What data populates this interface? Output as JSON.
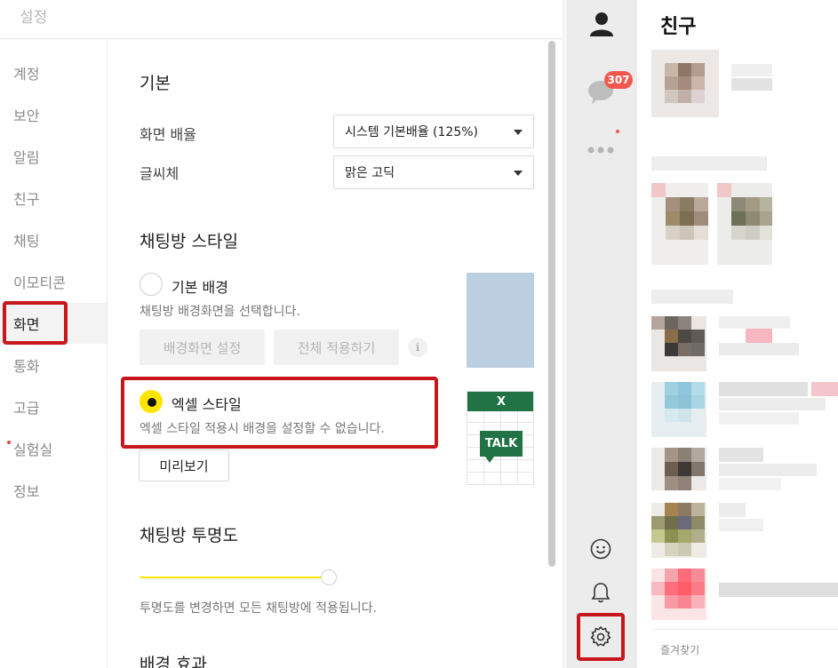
{
  "settings": {
    "title": "설정",
    "nav": [
      "계정",
      "보안",
      "알림",
      "친구",
      "채팅",
      "이모티콘",
      "화면",
      "통화",
      "고급",
      "실험실",
      "정보"
    ],
    "active_nav": "화면",
    "basic": {
      "heading": "기본",
      "scale_label": "화면 배율",
      "scale_value": "시스템 기본배율 (125%)",
      "font_label": "글씨체",
      "font_value": "맑은 고딕"
    },
    "chat_style": {
      "heading": "채팅방 스타일",
      "basic_bg_label": "기본 배경",
      "basic_bg_desc": "채팅방 배경화면을 선택합니다.",
      "set_bg_button": "배경화면 설정",
      "apply_all_button": "전체 적용하기",
      "info_icon": "i",
      "excel_label": "엑셀 스타일",
      "excel_desc": "엑셀 스타일 적용시 배경을 설정할 수 없습니다.",
      "preview_button": "미리보기",
      "selected": "엑셀 스타일",
      "excel_header": "X",
      "excel_talk": "TALK"
    },
    "transparency": {
      "heading": "채팅방 투명도",
      "level": 1.0,
      "desc": "투명도를 변경하면 모든 채팅방에 적용됩니다."
    },
    "bg_effect": {
      "heading": "배경 효과"
    }
  },
  "sidebar": {
    "chat_badge": "307",
    "icons": [
      "person-icon",
      "chat-bubble-icon",
      "more-icon",
      "emoji-icon",
      "bell-icon",
      "gear-icon"
    ]
  },
  "friends": {
    "title": "친구",
    "favorites_label": "즐겨찾기"
  },
  "colors": {
    "accent_yellow": "#fee500",
    "highlight_red": "#c8161d",
    "badge_red": "#f2584f",
    "excel_green": "#217346"
  }
}
